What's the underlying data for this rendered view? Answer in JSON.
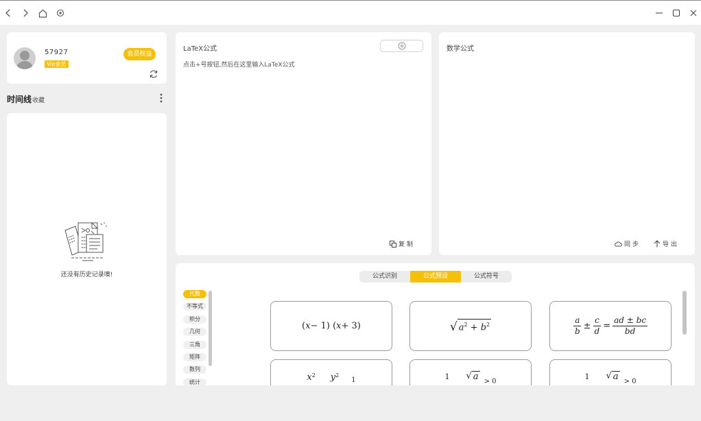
{
  "colors": {
    "accent": "#f6bf0a",
    "card": "#ffffff",
    "background": "#efefef"
  },
  "titlebar": {
    "icons": [
      "back-icon",
      "forward-icon",
      "home-icon",
      "target-icon",
      "minimize-icon",
      "maximize-icon",
      "close-icon"
    ]
  },
  "user": {
    "username": "57927",
    "vip_label": "Vip会员",
    "member_button": "会员权益",
    "refresh_icon": "refresh-icon"
  },
  "timeline": {
    "title": "时间线",
    "subtitle": "收藏",
    "empty_text": "还没有历史记录噢!"
  },
  "latex_panel": {
    "title": "LaTeX公式",
    "hint": "点击+号按钮,然后在这里输入LaTeX公式",
    "copy_label": "复制"
  },
  "math_panel": {
    "title": "数学公式",
    "sync_label": "同步",
    "export_label": "导出"
  },
  "formula_panel": {
    "tabs": [
      "公式识别",
      "公式预设",
      "公式符号"
    ],
    "active_tab": "公式预设",
    "categories": [
      "代数",
      "不等式",
      "积分",
      "几何",
      "三角",
      "矩阵",
      "数列",
      "统计"
    ],
    "active_category": "代数",
    "presets": [
      {
        "f1": "(",
        "f2": "x",
        "f3": " − 1) (",
        "f4": "x",
        "f5": " + 3)"
      },
      {
        "a": "a",
        "b": "b",
        "p": "2"
      },
      {
        "n1": "a",
        "d1": "b",
        "pm": "±",
        "n2": "c",
        "d2": "d",
        "eq": "=",
        "n3": "ad ± bc",
        "d3": "bd"
      },
      {
        "x": "x",
        "y": "y",
        "p": "2",
        "one": "1"
      },
      {
        "one": "1",
        "a": "a",
        "gt": "> 0"
      },
      {
        "one": "1",
        "a": "a",
        "gt": "> 0"
      }
    ]
  }
}
